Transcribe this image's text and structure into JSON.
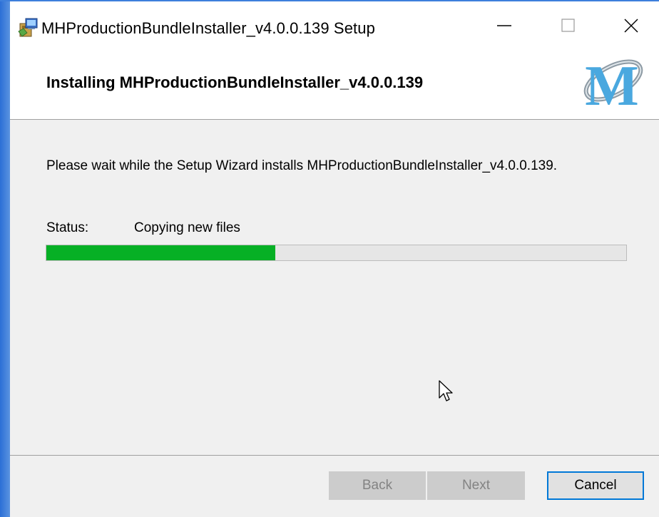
{
  "window": {
    "title": "MHProductionBundleInstaller_v4.0.0.139 Setup",
    "app_icon": "installer-package-icon",
    "controls": [
      "minimize-icon",
      "maximize-icon",
      "close-icon"
    ]
  },
  "header": {
    "title": "Installing MHProductionBundleInstaller_v4.0.0.139",
    "logo_text": "M",
    "logo_icon": "product-logo-icon"
  },
  "body": {
    "description": "Please wait while the Setup Wizard installs MHProductionBundleInstaller_v4.0.0.139.",
    "status_label": "Status:",
    "status_value": "Copying new files",
    "progress_percent": 39.5,
    "progress_color": "#06b025"
  },
  "footer": {
    "back_label": "Back",
    "next_label": "Next",
    "cancel_label": "Cancel"
  }
}
